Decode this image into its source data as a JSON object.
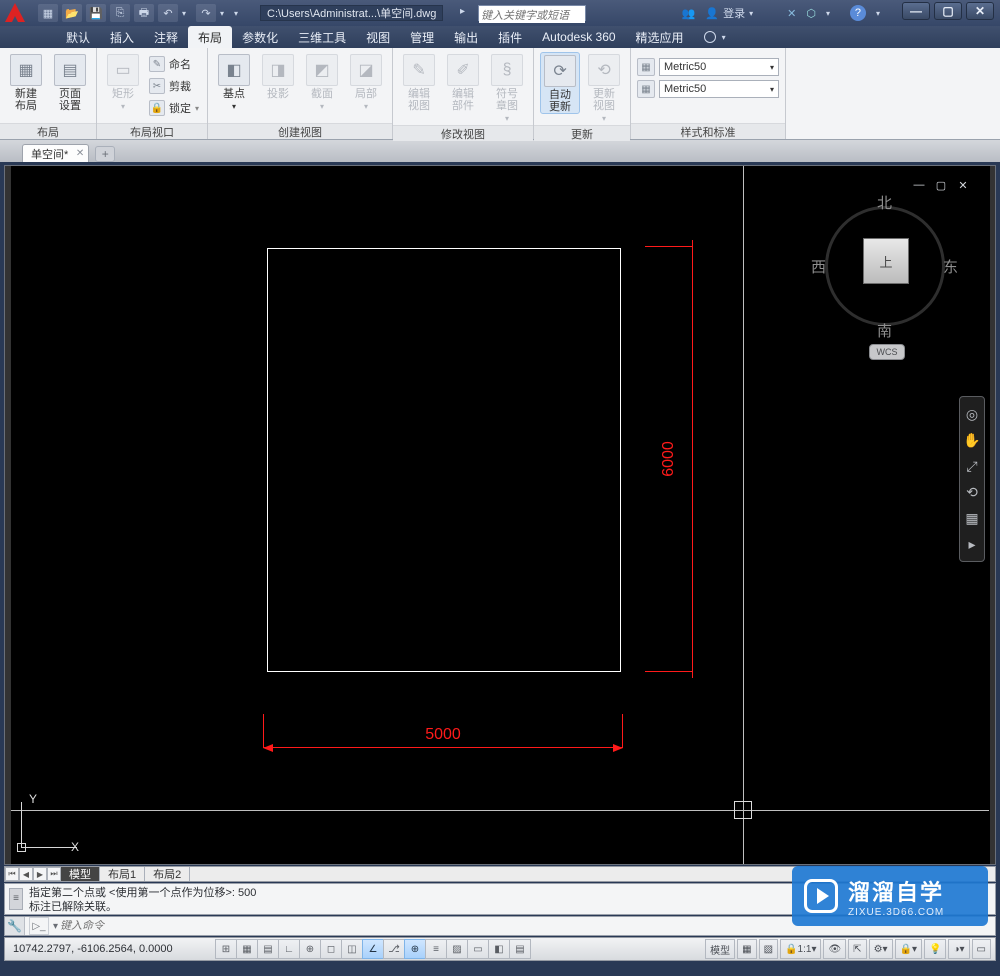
{
  "title_path": "C:\\Users\\Administrat...\\单空间.dwg",
  "search_placeholder": "键入关键字或短语",
  "login_label": "登录",
  "menu": {
    "items": [
      "默认",
      "插入",
      "注释",
      "布局",
      "参数化",
      "三维工具",
      "视图",
      "管理",
      "输出",
      "插件",
      "Autodesk 360",
      "精选应用"
    ],
    "active_index": 3
  },
  "ribbon": {
    "panels": [
      {
        "title": "布局",
        "big": [
          {
            "label": "新建\n布局",
            "icon": "▦"
          },
          {
            "label": "页面\n设置",
            "icon": "▤"
          }
        ]
      },
      {
        "title": "布局视口",
        "big": [
          {
            "label": "矩形",
            "icon": "▭",
            "disabled": true,
            "dd": true
          }
        ],
        "small": [
          {
            "label": "命名",
            "icon": "✎"
          },
          {
            "label": "剪裁",
            "icon": "✂"
          },
          {
            "label": "锁定",
            "icon": "🔒",
            "dd": true
          }
        ]
      },
      {
        "title": "创建视图",
        "big": [
          {
            "label": "基点",
            "icon": "◧",
            "dd": true
          },
          {
            "label": "投影",
            "icon": "◨",
            "disabled": true
          },
          {
            "label": "截面",
            "icon": "◩",
            "disabled": true,
            "dd": true
          },
          {
            "label": "局部",
            "icon": "◪",
            "disabled": true,
            "dd": true
          }
        ]
      },
      {
        "title": "修改视图",
        "big": [
          {
            "label": "编辑\n视图",
            "icon": "✎",
            "disabled": true
          },
          {
            "label": "编辑\n部件",
            "icon": "✐",
            "disabled": true
          },
          {
            "label": "符号\n章图",
            "icon": "§",
            "disabled": true,
            "dd": true
          }
        ]
      },
      {
        "title": "更新",
        "big": [
          {
            "label": "自动\n更新",
            "icon": "⟳",
            "pressed": true
          },
          {
            "label": "更新\n视图",
            "icon": "⟲",
            "disabled": true,
            "dd": true
          }
        ]
      },
      {
        "title": "样式和标准",
        "dropdowns": [
          {
            "value": "Metric50"
          },
          {
            "value": "Metric50"
          }
        ]
      }
    ]
  },
  "filetab": {
    "name": "单空间*"
  },
  "viewcube": {
    "face": "上",
    "n": "北",
    "s": "南",
    "e": "东",
    "w": "西",
    "wcs": "WCS"
  },
  "drawing": {
    "dim_h": "5000",
    "dim_v": "6000"
  },
  "ucs": {
    "x": "X",
    "y": "Y"
  },
  "model_tabs": {
    "items": [
      "模型",
      "布局1",
      "布局2"
    ],
    "active": 0
  },
  "cmd_history": {
    "l1": "指定第二个点或 <使用第一个点作为位移>: 500",
    "l2": "标注已解除关联。"
  },
  "cmd_placeholder": "键入命令",
  "status": {
    "coords": "10742.2797, -6106.2564, 0.0000",
    "model_btn": "模型",
    "scale": "1:1",
    "ann": "▲"
  },
  "watermark": {
    "brand": "溜溜自学",
    "url": "ZIXUE.3D66.COM"
  }
}
